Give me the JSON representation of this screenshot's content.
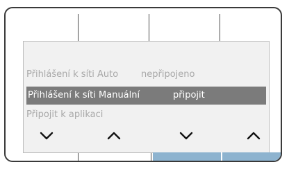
{
  "menu": {
    "items": [
      {
        "label": "Přihlášení k síti Auto",
        "value": "nepřipojeno"
      },
      {
        "label": "Přihlášení k síti Manuální",
        "value": "připojit"
      },
      {
        "label": "Připojit k aplikaci"
      }
    ],
    "selected_index": 1
  },
  "nav_buttons": [
    {
      "icon": "chevron-down-icon"
    },
    {
      "icon": "chevron-up-icon"
    },
    {
      "icon": "chevron-down-icon"
    },
    {
      "icon": "chevron-up-icon"
    }
  ],
  "colors": {
    "screen_background": "#f1f1f1",
    "selection_background": "#7b7b7b",
    "inactive_text": "#a8a8a8",
    "active_text": "#ffffff",
    "softkey_highlight": "#8db3cf",
    "bezel_outline": "#3a3a3a"
  }
}
